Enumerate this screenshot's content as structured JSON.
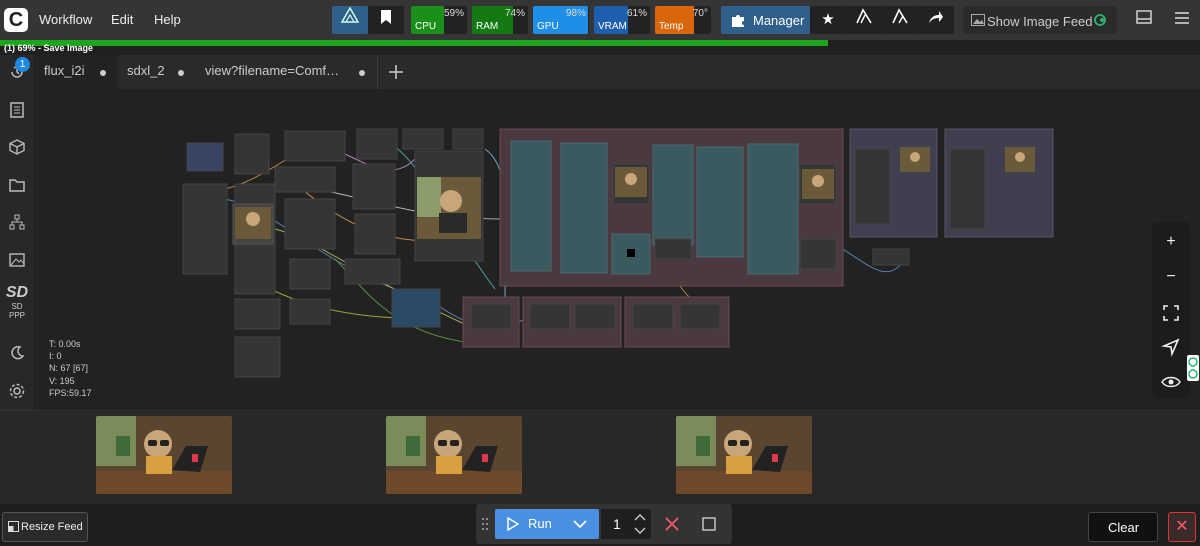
{
  "app": {
    "logo_glyph": "C"
  },
  "menu": [
    {
      "label": "Workflow"
    },
    {
      "label": "Edit"
    },
    {
      "label": "Help"
    }
  ],
  "monitors": [
    {
      "label": "CPU",
      "value": "59%",
      "percent": 59,
      "color": "#1a8f1a"
    },
    {
      "label": "RAM",
      "value": "74%",
      "percent": 74,
      "color": "#137a13"
    },
    {
      "label": "GPU",
      "value": "98%",
      "percent": 98,
      "color": "#1f8ee6"
    },
    {
      "label": "VRAM",
      "value": "61%",
      "percent": 61,
      "color": "#1f5fb0"
    },
    {
      "label": "Temp",
      "value": "70°",
      "percent": 70,
      "color": "#d9660a"
    }
  ],
  "toolbar": {
    "manager_label": "Manager",
    "show_feed_label": "Show Image Feed"
  },
  "progress": {
    "text": "(1) 69% - Save Image",
    "percent": 69
  },
  "sidebar": {
    "queue_badge": "1",
    "sdppp_label": "SD PPP"
  },
  "tabs": [
    {
      "label": "flux_i2i",
      "active": true
    },
    {
      "label": "sdxl_2",
      "active": false
    },
    {
      "label": "view?filename=Comf…",
      "active": false
    }
  ],
  "stats": {
    "t": "T: 0.00s",
    "i": "I: 0",
    "n": "N: 67 [67]",
    "v": "V: 195",
    "fps": "FPS:59.17"
  },
  "feed": {
    "resize_label": "Resize Feed",
    "clear_label": "Clear"
  },
  "run": {
    "run_label": "Run",
    "count": "1"
  },
  "colors": {
    "accent": "#3b82f6",
    "run": "#4a90e2",
    "danger": "#ff5a6a"
  }
}
